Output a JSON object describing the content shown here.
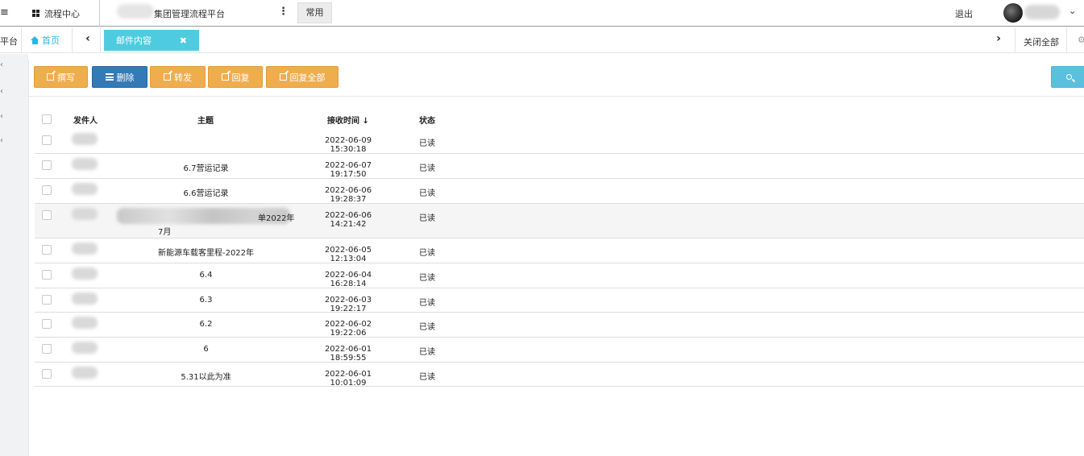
{
  "topbar": {
    "menu": "flow-center-menu",
    "flow_center": "流程中心",
    "platform": "集团管理流程平台",
    "more": "⋮",
    "common": "常用",
    "logout": "退出"
  },
  "tabbar": {
    "left_cut": "平台",
    "home": "首页",
    "active_tab": "邮件内容",
    "close_x": "✖",
    "close_all": "关闭全部",
    "prev": "‹",
    "next": "›"
  },
  "toolbar": {
    "compose": "撰写",
    "delete": "删除",
    "forward": "转发",
    "reply": "回复",
    "reply_all": "回复全部"
  },
  "table": {
    "headers": {
      "sender": "发件人",
      "subject": "主题",
      "received": "接收时间",
      "sort_arrow": "↓",
      "status": "状态"
    },
    "rows": [
      {
        "subject": "",
        "time": "2022-06-09 15:30:18",
        "status": "已读"
      },
      {
        "subject": "6.7营运记录",
        "time": "2022-06-07 19:17:50",
        "status": "已读"
      },
      {
        "subject": "6.6营运记录",
        "time": "2022-06-06 19:28:37",
        "status": "已读"
      },
      {
        "subject": "单2022年",
        "subject_line2": "7月",
        "time": "2022-06-06 14:21:42",
        "status": "已读"
      },
      {
        "subject": "新能源车载客里程-2022年",
        "time": "2022-06-05 12:13:04",
        "status": "已读"
      },
      {
        "subject": "6.4",
        "time": "2022-06-04 16:28:14",
        "status": "已读"
      },
      {
        "subject": "6.3",
        "time": "2022-06-03 19:22:17",
        "status": "已读"
      },
      {
        "subject": "6.2",
        "time": "2022-06-02 19:22:06",
        "status": "已读"
      },
      {
        "subject": "6",
        "time": "2022-06-01 18:59:55",
        "status": "已读"
      },
      {
        "subject": "5.31以此为准",
        "time": "2022-06-01 10:01:09",
        "status": "已读"
      }
    ]
  },
  "colors": {
    "accent": "#4fcbe0",
    "warning": "#f0ad4e",
    "primary": "#337ab7",
    "info": "#5bc0de"
  }
}
